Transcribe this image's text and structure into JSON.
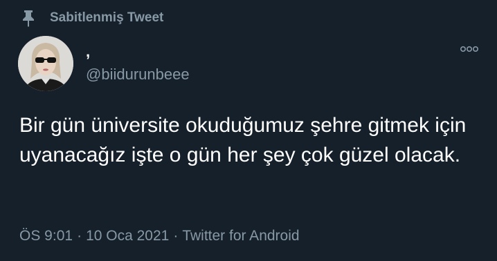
{
  "pinned_label": "Sabitlenmiş Tweet",
  "author": {
    "display_name": ",",
    "handle": "@biidurunbeee"
  },
  "tweet_text": "Bir gün üniversite okuduğumuz şehre gitmek için uyanacağız işte o gün her şey çok güzel olacak.",
  "meta": {
    "time": "ÖS 9:01",
    "date": "10 Oca 2021",
    "separator": "·",
    "source": "Twitter for Android"
  },
  "icons": {
    "pin": "pin-icon",
    "more": "more-options-icon"
  },
  "colors": {
    "background": "#15202b",
    "text_primary": "#ffffff",
    "text_secondary": "#8899a6"
  }
}
